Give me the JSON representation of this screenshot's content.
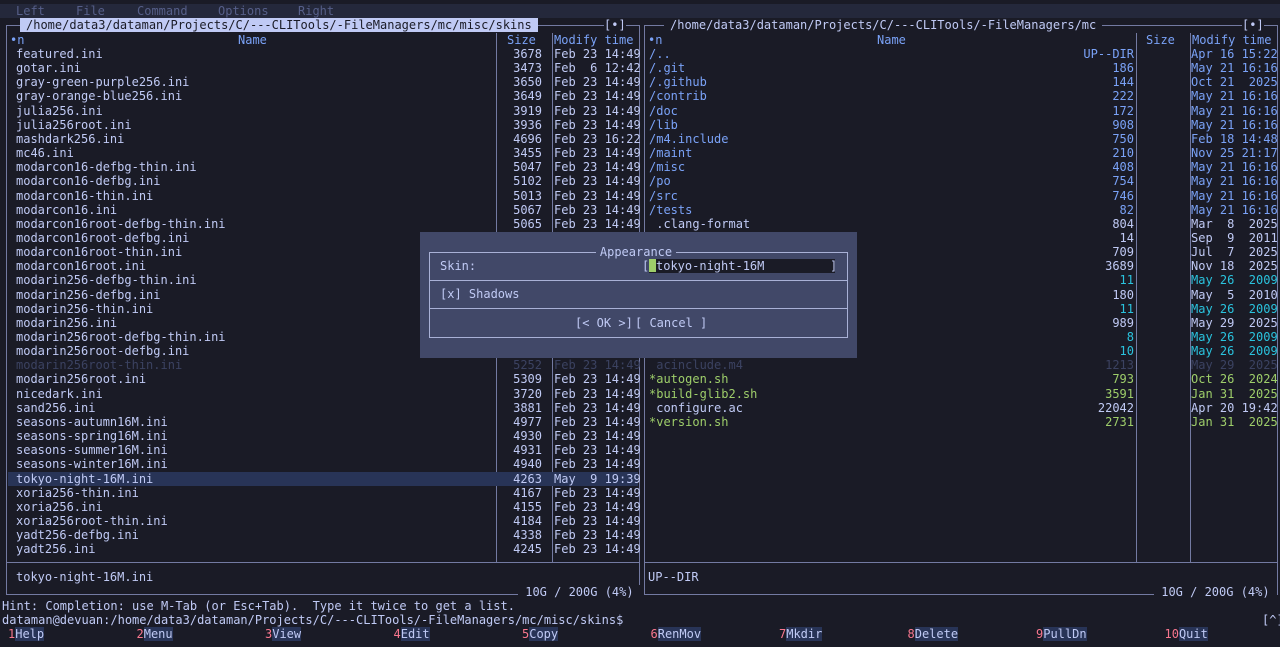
{
  "menubar": {
    "items": [
      "Left",
      "File",
      "Command",
      "Options",
      "Right"
    ]
  },
  "left_panel": {
    "path": "/home/data3/dataman/Projects/C/---CLITools/-FileManagers/mc/misc/skins",
    "corner": "[•]",
    "sort_indicator": "•n",
    "headers": {
      "name": "Name",
      "size": "Size",
      "modify": "Modify time"
    },
    "files": [
      {
        "name": "featured.ini",
        "size": "3678",
        "time": "Feb 23 14:49"
      },
      {
        "name": "gotar.ini",
        "size": "3473",
        "time": "Feb  6 12:42"
      },
      {
        "name": "gray-green-purple256.ini",
        "size": "3650",
        "time": "Feb 23 14:49"
      },
      {
        "name": "gray-orange-blue256.ini",
        "size": "3649",
        "time": "Feb 23 14:49"
      },
      {
        "name": "julia256.ini",
        "size": "3919",
        "time": "Feb 23 14:49"
      },
      {
        "name": "julia256root.ini",
        "size": "3936",
        "time": "Feb 23 14:49"
      },
      {
        "name": "mashdark256.ini",
        "size": "4696",
        "time": "Feb 23 16:22"
      },
      {
        "name": "mc46.ini",
        "size": "3455",
        "time": "Feb 23 14:49"
      },
      {
        "name": "modarcon16-defbg-thin.ini",
        "size": "5047",
        "time": "Feb 23 14:49"
      },
      {
        "name": "modarcon16-defbg.ini",
        "size": "5102",
        "time": "Feb 23 14:49"
      },
      {
        "name": "modarcon16-thin.ini",
        "size": "5013",
        "time": "Feb 23 14:49"
      },
      {
        "name": "modarcon16.ini",
        "size": "5067",
        "time": "Feb 23 14:49"
      },
      {
        "name": "modarcon16root-defbg-thin.ini",
        "size": "5065",
        "time": "Feb 23 14:49"
      },
      {
        "name": "modarcon16root-defbg.ini",
        "size": "",
        "time": ""
      },
      {
        "name": "modarcon16root-thin.ini",
        "size": "",
        "time": ""
      },
      {
        "name": "modarcon16root.ini",
        "size": "",
        "time": ""
      },
      {
        "name": "modarin256-defbg-thin.ini",
        "size": "",
        "time": ""
      },
      {
        "name": "modarin256-defbg.ini",
        "size": "",
        "time": ""
      },
      {
        "name": "modarin256-thin.ini",
        "size": "",
        "time": ""
      },
      {
        "name": "modarin256.ini",
        "size": "",
        "time": ""
      },
      {
        "name": "modarin256root-defbg-thin.ini",
        "size": "",
        "time": ""
      },
      {
        "name": "modarin256root-defbg.ini",
        "size": "",
        "time": ""
      },
      {
        "name": "modarin256root-thin.ini",
        "size": "5252",
        "time": "Feb 23 14:49",
        "dim": true
      },
      {
        "name": "modarin256root.ini",
        "size": "5309",
        "time": "Feb 23 14:49"
      },
      {
        "name": "nicedark.ini",
        "size": "3720",
        "time": "Feb 23 14:49"
      },
      {
        "name": "sand256.ini",
        "size": "3881",
        "time": "Feb 23 14:49"
      },
      {
        "name": "seasons-autumn16M.ini",
        "size": "4977",
        "time": "Feb 23 14:49"
      },
      {
        "name": "seasons-spring16M.ini",
        "size": "4930",
        "time": "Feb 23 14:49"
      },
      {
        "name": "seasons-summer16M.ini",
        "size": "4931",
        "time": "Feb 23 14:49"
      },
      {
        "name": "seasons-winter16M.ini",
        "size": "4940",
        "time": "Feb 23 14:49"
      },
      {
        "name": "tokyo-night-16M.ini",
        "size": "4263",
        "time": "May  9 19:39",
        "selected": true
      },
      {
        "name": "xoria256-thin.ini",
        "size": "4167",
        "time": "Feb 23 14:49"
      },
      {
        "name": "xoria256.ini",
        "size": "4155",
        "time": "Feb 23 14:49"
      },
      {
        "name": "xoria256root-thin.ini",
        "size": "4184",
        "time": "Feb 23 14:49"
      },
      {
        "name": "yadt256-defbg.ini",
        "size": "4338",
        "time": "Feb 23 14:49"
      },
      {
        "name": "yadt256.ini",
        "size": "4245",
        "time": "Feb 23 14:49"
      }
    ],
    "status": "tokyo-night-16M.ini",
    "disk": " 10G / 200G (4%) "
  },
  "right_panel": {
    "path": "/home/data3/dataman/Projects/C/---CLITools/-FileManagers/mc",
    "corner": "[•]",
    "sort_indicator": "•n",
    "headers": {
      "name": "Name",
      "size": "Size",
      "modify": "Modify time"
    },
    "files": [
      {
        "name": "/..",
        "size": "UP--DIR",
        "time": "Apr 16 15:22",
        "kind": "dir"
      },
      {
        "name": "/.git",
        "size": "186",
        "time": "May 21 16:16",
        "kind": "dir"
      },
      {
        "name": "/.github",
        "size": "144",
        "time": "Oct 21  2025",
        "kind": "dir"
      },
      {
        "name": "/contrib",
        "size": "222",
        "time": "May 21 16:16",
        "kind": "dir"
      },
      {
        "name": "/doc",
        "size": "172",
        "time": "May 21 16:16",
        "kind": "dir"
      },
      {
        "name": "/lib",
        "size": "908",
        "time": "May 21 16:16",
        "kind": "dir"
      },
      {
        "name": "/m4.include",
        "size": "750",
        "time": "Feb 18 14:48",
        "kind": "dir"
      },
      {
        "name": "/maint",
        "size": "210",
        "time": "Nov 25 21:17",
        "kind": "dir"
      },
      {
        "name": "/misc",
        "size": "408",
        "time": "May 21 16:16",
        "kind": "dir"
      },
      {
        "name": "/po",
        "size": "754",
        "time": "May 21 16:16",
        "kind": "dir"
      },
      {
        "name": "/src",
        "size": "746",
        "time": "May 21 16:16",
        "kind": "dir"
      },
      {
        "name": "/tests",
        "size": "82",
        "time": "May 21 16:16",
        "kind": "dir"
      },
      {
        "name": " .clang-format",
        "size": "804",
        "time": "Mar  8  2025",
        "kind": "file"
      },
      {
        "name": "",
        "size": "14",
        "time": "Sep  9  2011",
        "kind": "file"
      },
      {
        "name": "",
        "size": "709",
        "time": "Jul  7  2025",
        "kind": "file"
      },
      {
        "name": "",
        "size": "3689",
        "time": "Nov 18  2025",
        "kind": "file"
      },
      {
        "name": "",
        "size": "11",
        "time": "May 26  2009",
        "kind": "cyan"
      },
      {
        "name": "",
        "size": "180",
        "time": "May  5  2010",
        "kind": "file"
      },
      {
        "name": "",
        "size": "11",
        "time": "May 26  2009",
        "kind": "cyan"
      },
      {
        "name": "",
        "size": "989",
        "time": "May 29  2025",
        "kind": "file"
      },
      {
        "name": "",
        "size": "8",
        "time": "May 26  2009",
        "kind": "cyan"
      },
      {
        "name": "",
        "size": "10",
        "time": "May 26  2009",
        "kind": "cyan"
      },
      {
        "name": " acinclude.m4",
        "size": "1213",
        "time": "May 29  2025",
        "kind": "dim"
      },
      {
        "name": "*autogen.sh",
        "size": "793",
        "time": "Oct 26  2024",
        "kind": "exe"
      },
      {
        "name": "*build-glib2.sh",
        "size": "3591",
        "time": "Jan 31  2025",
        "kind": "exe"
      },
      {
        "name": " configure.ac",
        "size": "22042",
        "time": "Apr 20 19:42",
        "kind": "file"
      },
      {
        "name": "*version.sh",
        "size": "2731",
        "time": "Jan 31  2025",
        "kind": "exe"
      }
    ],
    "status": "UP--DIR",
    "disk": " 10G / 200G (4%) "
  },
  "dialog": {
    "title": "Appearance",
    "skin_label": "Skin:",
    "skin_value": "tokyo-night-16M",
    "shadows_label": "[x] Shadows",
    "ok": "[< OK >]",
    "cancel": "[ Cancel ]"
  },
  "hint": "Hint: Completion: use M-Tab (or Esc+Tab).  Type it twice to get a list.",
  "prompt": "dataman@devuan:/home/data3/dataman/Projects/C/---CLITools/-FileManagers/mc/misc/skins$",
  "prompt_corner": "[^]",
  "fkeys": [
    {
      "num": "1",
      "label": "Help"
    },
    {
      "num": "2",
      "label": "Menu"
    },
    {
      "num": "3",
      "label": "View"
    },
    {
      "num": "4",
      "label": "Edit"
    },
    {
      "num": "5",
      "label": "Copy"
    },
    {
      "num": "6",
      "label": "RenMov"
    },
    {
      "num": "7",
      "label": "Mkdir"
    },
    {
      "num": "8",
      "label": "Delete"
    },
    {
      "num": "9",
      "label": "PullDn"
    },
    {
      "num": "10",
      "label": "Quit"
    }
  ]
}
